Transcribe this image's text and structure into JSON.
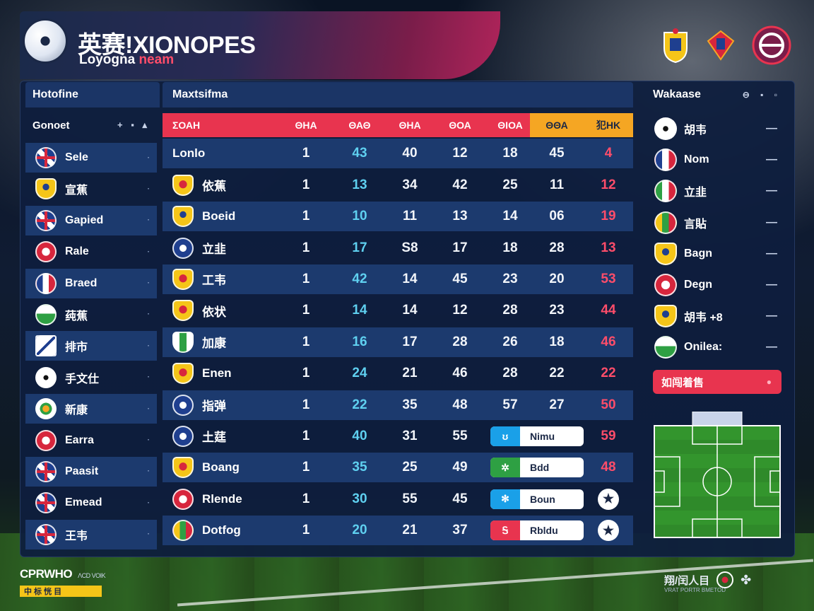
{
  "header": {
    "title": "英赛!XIONOPES",
    "subtitle_main": "Loyogna ",
    "subtitle_highlight": "neam"
  },
  "left_panel": {
    "title": "Hotofine",
    "subheader": "Gonoet",
    "controls": "+ ▪ ▴",
    "items": [
      {
        "label": "Sele",
        "flag": "uk"
      },
      {
        "label": "宣蕉",
        "flag": "shield"
      },
      {
        "label": "Gapied",
        "flag": "uk"
      },
      {
        "label": "Rale",
        "flag": "red"
      },
      {
        "label": "Braed",
        "flag": "tri"
      },
      {
        "label": "莼蕉",
        "flag": "green"
      },
      {
        "label": "排市",
        "flag": "square"
      },
      {
        "label": "手文仕",
        "flag": "ball"
      },
      {
        "label": "新康",
        "flag": "ring"
      },
      {
        "label": "Earra",
        "flag": "red"
      },
      {
        "label": "Paasit",
        "flag": "uk"
      },
      {
        "label": "Emead",
        "flag": "uk"
      },
      {
        "label": "王韦",
        "flag": "uk"
      }
    ]
  },
  "table": {
    "title": "Maxtsifma",
    "headers": [
      "ΣΟΑΗ",
      "ΘΗΑ",
      "ΘΑΘ",
      "ΘΗΑ",
      "ΘΟΑ",
      "ΘΙΟΑ",
      "ΘΘΑ",
      "犯ΗΚ"
    ],
    "rows": [
      {
        "team": "Lonlo",
        "flag": "",
        "c1": "1",
        "c2": "43",
        "c3": "40",
        "c4": "12",
        "c5": "18",
        "c6": "45",
        "c7": "4"
      },
      {
        "team": "依蕉",
        "flag": "redshield",
        "c1": "1",
        "c2": "13",
        "c3": "34",
        "c4": "42",
        "c5": "25",
        "c6": "11",
        "c7": "12"
      },
      {
        "team": "Boeid",
        "flag": "shield",
        "c1": "1",
        "c2": "10",
        "c3": "11",
        "c4": "13",
        "c5": "14",
        "c6": "06",
        "c7": "19"
      },
      {
        "team": "立韭",
        "flag": "blue",
        "c1": "1",
        "c2": "17",
        "c3": "S8",
        "c4": "17",
        "c5": "18",
        "c6": "28",
        "c7": "13"
      },
      {
        "team": "工韦",
        "flag": "redshield",
        "c1": "1",
        "c2": "42",
        "c3": "14",
        "c4": "45",
        "c5": "23",
        "c6": "20",
        "c7": "53"
      },
      {
        "team": "依状",
        "flag": "redshield",
        "c1": "1",
        "c2": "14",
        "c3": "14",
        "c4": "12",
        "c5": "28",
        "c6": "23",
        "c7": "44"
      },
      {
        "team": "加康",
        "flag": "greenshield",
        "c1": "1",
        "c2": "16",
        "c3": "17",
        "c4": "28",
        "c5": "26",
        "c6": "18",
        "c7": "46"
      },
      {
        "team": "Enen",
        "flag": "redshield",
        "c1": "1",
        "c2": "24",
        "c3": "21",
        "c4": "46",
        "c5": "28",
        "c6": "22",
        "c7": "22"
      },
      {
        "team": "指弹",
        "flag": "blue",
        "c1": "1",
        "c2": "22",
        "c3": "35",
        "c4": "48",
        "c5": "57",
        "c6": "27",
        "c7": "50"
      },
      {
        "team": "土莛",
        "flag": "blue",
        "c1": "1",
        "c2": "40",
        "c3": "31",
        "c4": "55",
        "pill": {
          "tag": "ʊ",
          "label": "Nimu",
          "color": "#1aa0e8"
        },
        "c7": "59"
      },
      {
        "team": "Boang",
        "flag": "redshield",
        "c1": "1",
        "c2": "35",
        "c3": "25",
        "c4": "49",
        "pill": {
          "tag": "✲",
          "label": "Bdd",
          "color": "#2ea043"
        },
        "c7": "48"
      },
      {
        "team": "Rlende",
        "flag": "red",
        "c1": "1",
        "c2": "30",
        "c3": "55",
        "c4": "45",
        "pill": {
          "tag": "✻",
          "label": "Boun",
          "color": "#1aa0e8"
        },
        "star": "★"
      },
      {
        "team": "Dotfog",
        "flag": "yellow",
        "c1": "1",
        "c2": "20",
        "c3": "21",
        "c4": "37",
        "pill": {
          "tag": "Ꭶ",
          "label": "Rbldu",
          "color": "#e8344f"
        },
        "star": "★"
      }
    ]
  },
  "right_panel": {
    "title": "Wakaase",
    "controls": "⊖ ▪ ▫",
    "items": [
      {
        "label": "胡韦",
        "flag": "ball"
      },
      {
        "label": "Nom",
        "flag": "tri"
      },
      {
        "label": "立韭",
        "flag": "italy"
      },
      {
        "label": "言貼",
        "flag": "yellow"
      },
      {
        "label": "Bagn",
        "flag": "shield"
      },
      {
        "label": "Degn",
        "flag": "red"
      },
      {
        "label": "胡韦 +8",
        "flag": "shield"
      },
      {
        "label": "Onilea:",
        "flag": "green"
      }
    ],
    "action_label": "如闯着售"
  },
  "footer": {
    "brand": "CPRWHO",
    "brand_sub": "ΛCD VOIK",
    "badge": "中 标 恍 目",
    "right_text": "翔/闰人目",
    "right_sub": "VRAT PORTR BMETOD"
  },
  "colors": {
    "accent_red": "#e8344f",
    "accent_gold": "#f5a623",
    "panel_bg": "#0e1e3e",
    "row_alt": "#1c3a6e",
    "cyan": "#5fd0f0"
  }
}
